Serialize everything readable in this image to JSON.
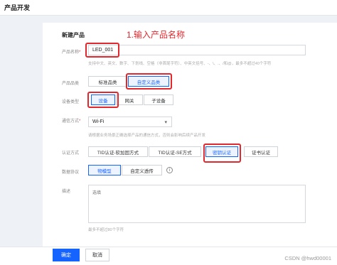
{
  "header": {
    "title": "产品开发"
  },
  "form": {
    "section_title": "新建产品",
    "annotation": "1.输入产品名称",
    "product_name": {
      "label": "产品名称",
      "required_mark": "*",
      "value": "LED_001",
      "hint": "支持中文、英文、数字、下划线、空格（非首尾字符）、中英文括号、-、\\、.、/和@，最多不超过40个字符"
    },
    "product_category": {
      "label": "产品品类",
      "options": [
        "标准品类",
        "自定义品类"
      ],
      "selected": "自定义品类"
    },
    "device_type": {
      "label": "设备类型",
      "options": [
        "设备",
        "网关",
        "子设备"
      ],
      "selected": "设备"
    },
    "comm_method": {
      "label": "通信方式",
      "required_mark": "*",
      "value": "Wi-Fi",
      "hint": "请根据业务场景正确选择产品的通信方式，否则会影响后续产品开发"
    },
    "auth_method": {
      "label": "认证方式",
      "options": [
        "TID认证-软加固方式",
        "TID认证-SE方式",
        "密钥认证",
        "证书认证"
      ],
      "selected": "密钥认证"
    },
    "data_protocol": {
      "label": "数据协议",
      "options": [
        "物模型",
        "自定义透传"
      ],
      "selected": "物模型",
      "info_icon": "i"
    },
    "description": {
      "label": "描述",
      "placeholder": "选填",
      "hint": "最多不超过80个字符"
    }
  },
  "footer": {
    "confirm_label": "确定",
    "cancel_label": "取消"
  },
  "watermark": "CSDN @hwd00001",
  "colors": {
    "accent": "#1664ff",
    "highlight": "#e0282e"
  }
}
